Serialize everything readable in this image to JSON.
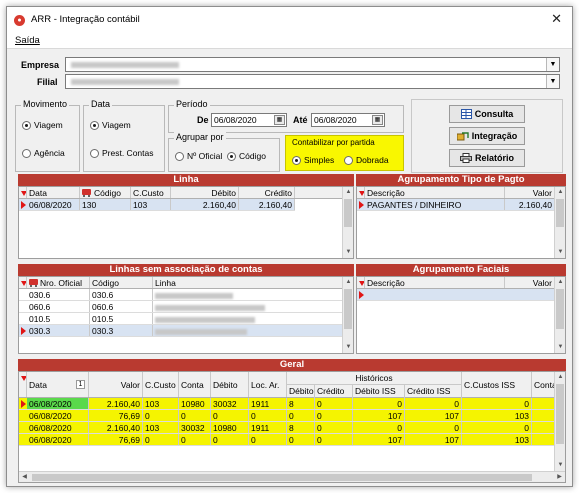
{
  "window": {
    "title": "ARR - Integração contábil",
    "close_glyph": "✕"
  },
  "menu": {
    "saida": "Saída"
  },
  "filters": {
    "empresa_label": "Empresa",
    "filial_label": "Filial"
  },
  "movimento": {
    "title": "Movimento",
    "options": [
      "Viagem",
      "Agência"
    ],
    "selected": "Viagem"
  },
  "data_group": {
    "title": "Data",
    "options": [
      "Viagem",
      "Prest. Contas"
    ],
    "selected": "Viagem"
  },
  "periodo": {
    "title": "Período",
    "de_label": "De",
    "de_value": "06/08/2020",
    "ate_label": "Até",
    "ate_value": "06/08/2020"
  },
  "agrupar": {
    "title": "Agrupar por",
    "options": [
      "Nº Oficial",
      "Código"
    ],
    "selected": "Código"
  },
  "contabilizar": {
    "title": "Contabilizar por partida",
    "options": [
      "Simples",
      "Dobrada"
    ],
    "selected": "Simples"
  },
  "buttons": {
    "consulta": "Consulta",
    "integracao": "Integração",
    "relatorio": "Relatório"
  },
  "linha": {
    "header": "Linha",
    "columns": [
      "Data",
      "Código",
      "C.Custo",
      "Débito",
      "Crédito"
    ],
    "rows": [
      [
        "06/08/2020",
        "130",
        "103",
        "2.160,40",
        "2.160,40"
      ]
    ]
  },
  "agrup_tipo": {
    "header": "Agrupamento Tipo de Pagto",
    "columns": [
      "Descrição",
      "Valor"
    ],
    "rows": [
      [
        "PAGANTES / DINHEIRO",
        "2.160,40"
      ]
    ]
  },
  "linhas_sem": {
    "header": "Linhas sem associação de contas",
    "columns": [
      "Nro. Oficial",
      "Código",
      "Linha"
    ],
    "rows": [
      [
        "030.6",
        "030.6"
      ],
      [
        "060.6",
        "060.6"
      ],
      [
        "010.5",
        "010.5"
      ],
      [
        "030.3",
        "030.3"
      ]
    ]
  },
  "agrup_faciais": {
    "header": "Agrupamento Faciais",
    "columns": [
      "Descrição",
      "Valor"
    ]
  },
  "geral": {
    "header": "Geral",
    "group_header": "Históricos",
    "sort_badge": "1",
    "columns": [
      "Data",
      "Valor",
      "C.Custo",
      "Conta",
      "Débito",
      "Loc. Ar.",
      "Débito",
      "Crédito",
      "Débito ISS",
      "Crédito ISS",
      "C.Custos ISS",
      "Conta"
    ],
    "rows": [
      [
        "06/08/2020",
        "2.160,40",
        "103",
        "10980",
        "30032",
        "1911",
        "8",
        "0",
        "0",
        "0",
        "0"
      ],
      [
        "06/08/2020",
        "76,69",
        "0",
        "0",
        "0",
        "0",
        "0",
        "0",
        "107",
        "107",
        "103"
      ],
      [
        "06/08/2020",
        "2.160,40",
        "103",
        "30032",
        "10980",
        "1911",
        "8",
        "0",
        "0",
        "0",
        "0"
      ],
      [
        "06/08/2020",
        "76,69",
        "0",
        "0",
        "0",
        "0",
        "0",
        "0",
        "107",
        "107",
        "103"
      ]
    ]
  },
  "colors": {
    "section_red": "#b93a30",
    "highlight_yellow": "#f5f400",
    "selected_green": "#5ad94b"
  }
}
